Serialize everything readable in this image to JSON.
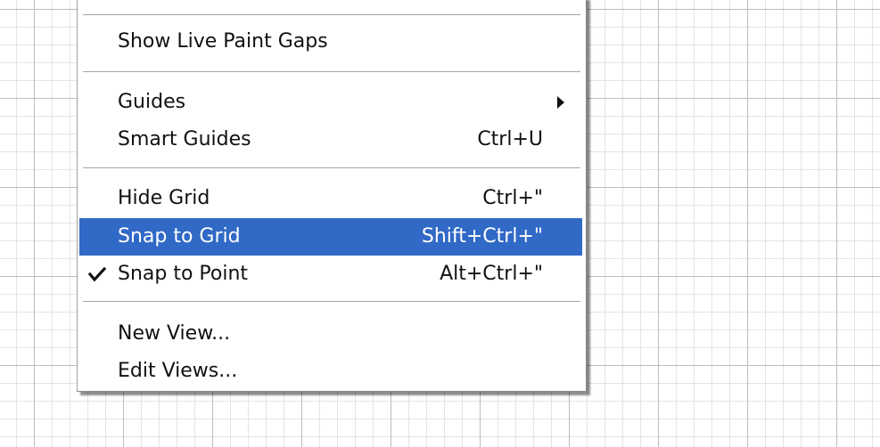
{
  "menu": {
    "items": [
      {
        "label": "Show Live Paint Gaps",
        "shortcut": ""
      },
      {
        "label": "Guides",
        "shortcut": "",
        "submenu": true
      },
      {
        "label": "Smart Guides",
        "shortcut": "Ctrl+U"
      },
      {
        "label": "Hide Grid",
        "shortcut": "Ctrl+\""
      },
      {
        "label": "Snap to Grid",
        "shortcut": "Shift+Ctrl+\"",
        "highlighted": true
      },
      {
        "label": "Snap to Point",
        "shortcut": "Alt+Ctrl+\"",
        "checked": true
      },
      {
        "label": "New View...",
        "shortcut": ""
      },
      {
        "label": "Edit Views...",
        "shortcut": ""
      }
    ]
  },
  "colors": {
    "highlight": "#3169c6",
    "grid_major": "#bdbdbd",
    "grid_minor": "#e4e4e4"
  },
  "icons": {
    "checkmark": "checkmark-icon",
    "submenu_arrow": "submenu-arrow-icon"
  }
}
